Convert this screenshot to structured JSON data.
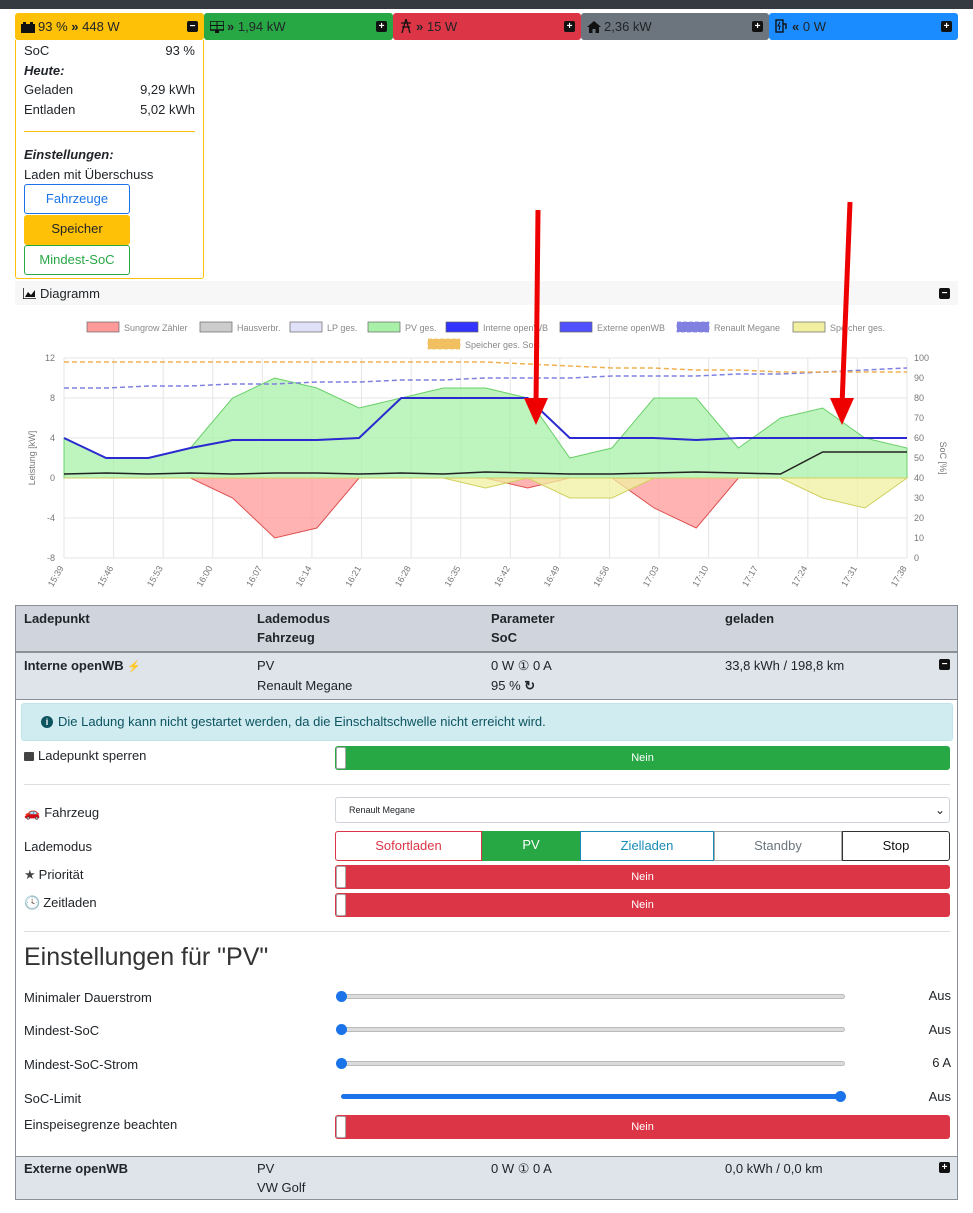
{
  "tiles": {
    "battery": {
      "text": "93 % ",
      "power": "448 W",
      "color": "#ffc107"
    },
    "pv": {
      "text": "1,94 kW",
      "color": "#28a745"
    },
    "grid": {
      "text": "15 W",
      "color": "#dc3545"
    },
    "house": {
      "text": "2,36 kW",
      "color": "#6c757d"
    },
    "charge": {
      "text": "0 W",
      "color": "#1a8cff"
    }
  },
  "storage_panel": {
    "soc_label": "SoC",
    "soc_value": "93 %",
    "today_label": "Heute:",
    "charged_label": "Geladen",
    "charged_value": "9,29 kWh",
    "discharged_label": "Entladen",
    "discharged_value": "5,02 kWh",
    "settings_label": "Einstellungen:",
    "mode_text": "Laden mit Überschuss",
    "btn_vehicles": "Fahrzeuge",
    "btn_storage": "Speicher",
    "btn_min_soc": "Mindest-SoC"
  },
  "diagram": {
    "title": "Diagramm",
    "chart_data": {
      "type": "area",
      "legend": [
        "Sungrow Zähler",
        "Hausverbr.",
        "LP ges.",
        "PV ges.",
        "Interne openWB",
        "Externe openWB",
        "Renault Megane",
        "Speicher ges.",
        "Speicher ges. SoC"
      ],
      "legend_colors": [
        "#ff9a9a",
        "#cccccc",
        "#e0e0f8",
        "#a8f0a8",
        "#3333ff",
        "#5050ff",
        "#8080e0",
        "#f0f0a0",
        "#f0c060"
      ],
      "ylabel": "Leistung [kW]",
      "y2label": "SoC [%]",
      "ylim": [
        -8,
        12
      ],
      "y2lim": [
        0,
        100
      ],
      "yticks": [
        "12",
        "8",
        "4",
        "0",
        "-4",
        "-8"
      ],
      "y2ticks": [
        "100",
        "90",
        "80",
        "70",
        "60",
        "50",
        "40",
        "30",
        "20",
        "10",
        "0"
      ],
      "xticks": [
        "15:39",
        "15:46",
        "15:53",
        "16:00",
        "16:07",
        "16:14",
        "16:21",
        "16:28",
        "16:35",
        "16:42",
        "16:49",
        "16:56",
        "17:03",
        "17:10",
        "17:17",
        "17:24",
        "17:31",
        "17:38"
      ],
      "series": [
        {
          "name": "PV ges.",
          "values": [
            4,
            2,
            2,
            3,
            8,
            10,
            9,
            7,
            8,
            9,
            9,
            8,
            2,
            3,
            8,
            8,
            3,
            6,
            7,
            4,
            3
          ]
        },
        {
          "name": "Sungrow Zähler",
          "values": [
            0,
            0,
            0,
            0,
            -2,
            -6,
            -5,
            0,
            0,
            0,
            0,
            -1,
            0,
            0,
            -3,
            -5,
            0,
            0,
            0,
            0,
            0
          ]
        },
        {
          "name": "Hausverbr.",
          "values": [
            0.4,
            0.5,
            0.4,
            0.5,
            0.4,
            0.5,
            0.5,
            0.4,
            0.5,
            0.4,
            0.6,
            0.5,
            0.4,
            0.4,
            0.5,
            0.6,
            0.5,
            0.4,
            2.6,
            2.6,
            2.6
          ]
        },
        {
          "name": "Interne openWB",
          "values": [
            4,
            2,
            2,
            3,
            3.8,
            3.8,
            3.8,
            4,
            8,
            8,
            8,
            8,
            4,
            4,
            4,
            3.8,
            4,
            4,
            4,
            4,
            4
          ]
        },
        {
          "name": "Speicher ges.",
          "values": [
            0,
            0,
            0,
            0,
            0,
            0,
            0,
            0,
            0,
            0,
            -1,
            0,
            -2,
            -2,
            0,
            0,
            0,
            0,
            -2,
            -3,
            0
          ]
        },
        {
          "name": "Renault Megane",
          "values": [
            85,
            85,
            86,
            86,
            87,
            87,
            88,
            88,
            89,
            89,
            90,
            90,
            90,
            91,
            91,
            91,
            92,
            92,
            93,
            94,
            95
          ]
        },
        {
          "name": "Speicher ges. SoC",
          "values": [
            98,
            98,
            98,
            98,
            98,
            98,
            98,
            98,
            98,
            98,
            98,
            97,
            96,
            95,
            95,
            94,
            94,
            93,
            93,
            93,
            93
          ]
        }
      ]
    }
  },
  "table": {
    "h_chargepoint": "Ladepunkt",
    "h_mode": "Lademodus",
    "h_vehicle": "Fahrzeug",
    "h_param": "Parameter",
    "h_soc": "SoC",
    "h_charged": "geladen",
    "lp1": {
      "name": "Interne openWB",
      "mode": "PV",
      "vehicle": "Renault Megane",
      "param": "0 W ① 0 A",
      "soc": "95 %",
      "charged": "33,8 kWh / 198,8 km"
    },
    "lp2": {
      "name": "Externe openWB",
      "mode": "PV",
      "vehicle": "VW Golf",
      "param": "0 W ① 0 A",
      "charged": "0,0 kWh / 0,0 km"
    }
  },
  "lp1_body": {
    "alert": "Die Ladung kann nicht gestartet werden, da die Einschaltschwelle nicht erreicht wird.",
    "lock_label": "Ladepunkt sperren",
    "lock_value": "Nein",
    "vehicle_label": "Fahrzeug",
    "vehicle_selected": "Renault Megane",
    "mode_label": "Lademodus",
    "modes": [
      "Sofortladen",
      "PV",
      "Zielladen",
      "Standby",
      "Stop"
    ],
    "priority_label": "Priorität",
    "priority_value": "Nein",
    "timed_label": "Zeitladen",
    "timed_value": "Nein",
    "pv_heading": "Einstellungen für \"PV\"",
    "min_current_label": "Minimaler Dauerstrom",
    "min_current_value": "Aus",
    "min_current_level": 0,
    "min_soc_label": "Mindest-SoC",
    "min_soc_value": "Aus",
    "min_soc_level": 0,
    "min_soc_current_label": "Mindest-SoC-Strom",
    "min_soc_current_value": "6 A",
    "min_soc_current_level": 0,
    "soc_limit_label": "SoC-Limit",
    "soc_limit_value": "Aus",
    "soc_limit_level": 1,
    "feed_in_label": "Einspeisegrenze beachten",
    "feed_in_value": "Nein"
  }
}
